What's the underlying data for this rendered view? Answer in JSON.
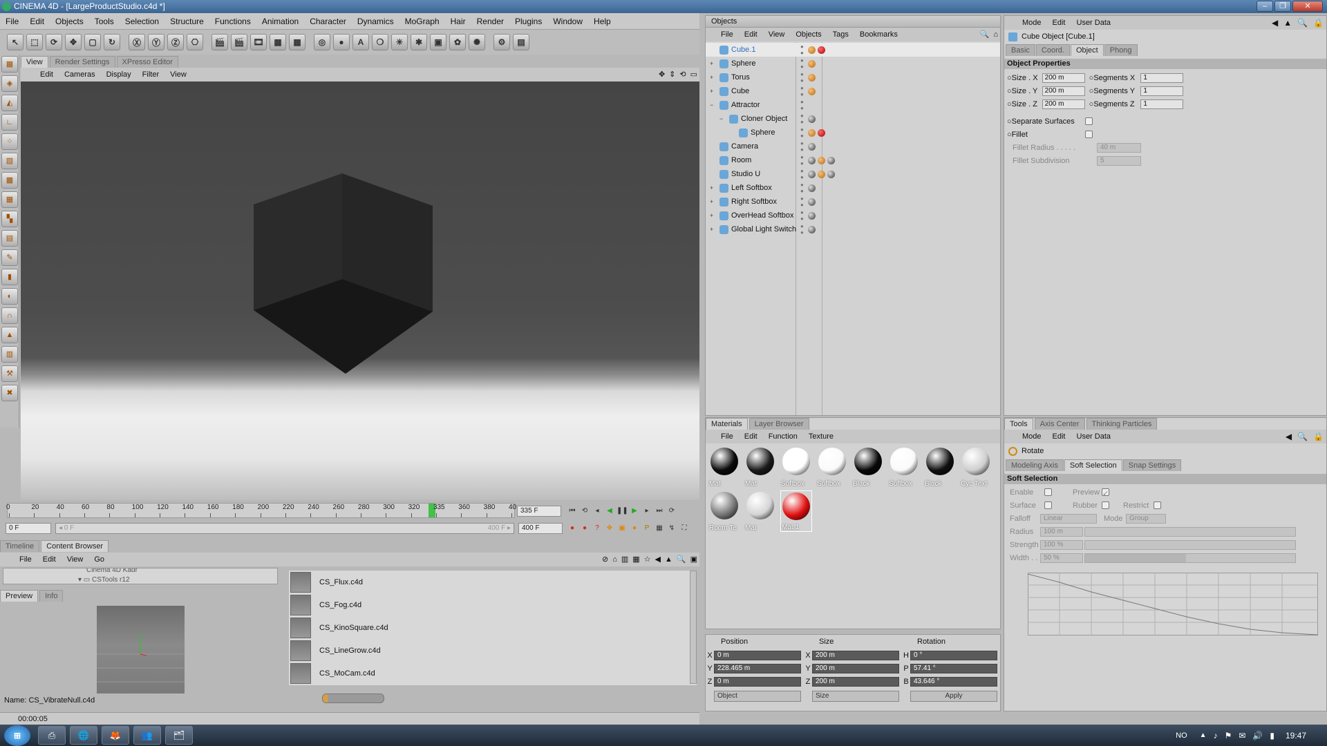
{
  "window": {
    "title": "CINEMA 4D - [LargeProductStudio.c4d *]",
    "buttons": [
      "–",
      "❐",
      "✕"
    ]
  },
  "menu": [
    "File",
    "Edit",
    "Objects",
    "Tools",
    "Selection",
    "Structure",
    "Functions",
    "Animation",
    "Character",
    "Dynamics",
    "MoGraph",
    "Hair",
    "Render",
    "Plugins",
    "Window",
    "Help"
  ],
  "toolbar": {
    "icons": [
      "↖",
      "⬚",
      "⟳",
      "✥",
      "▢",
      "↻",
      "Ⓧ",
      "Ⓨ",
      "Ⓩ",
      "⎔",
      "🎬",
      "🎬",
      "🎞",
      "▦",
      "▦",
      "◎",
      "●",
      "A",
      "❍",
      "✳",
      "✱",
      "▣",
      "✿",
      "✺",
      "⚙",
      "▤"
    ]
  },
  "viewport": {
    "tabs": [
      "View",
      "Render Settings",
      "XPresso Editor"
    ],
    "menu": [
      "Edit",
      "Cameras",
      "Display",
      "Filter",
      "View"
    ],
    "nav_icons": [
      "✥",
      "⇕",
      "⟲",
      "▭"
    ]
  },
  "timeline": {
    "ticks": [
      "0",
      "20",
      "40",
      "60",
      "80",
      "100",
      "120",
      "140",
      "160",
      "180",
      "200",
      "220",
      "240",
      "260",
      "280",
      "300",
      "320",
      "335",
      "360",
      "380",
      "40"
    ],
    "current_frame": "335 F",
    "start": "0 F",
    "range_start": "◂ 0 F",
    "range_end": "400 F ▸",
    "end": "400 F",
    "playhead_fraction": 0.8375
  },
  "playback": [
    "⏮",
    "⟲",
    "◂",
    "◀",
    "❚❚",
    "▶",
    "▸",
    "⏭",
    "⟳"
  ],
  "keys": [
    "●",
    "●",
    "?",
    "✥",
    "▣",
    "●",
    "P",
    "▦",
    "↯",
    "⛶"
  ],
  "bottom_tabs": [
    "Timeline",
    "Content Browser"
  ],
  "content_browser": {
    "menu": [
      "File",
      "Edit",
      "View",
      "Go"
    ],
    "tree": [
      "Cinema 4D Kadr",
      "CSTools r12"
    ],
    "preview_tabs": [
      "Preview",
      "Info"
    ],
    "name": "Name: CS_VibrateNull.c4d",
    "files": [
      "CS_Flux.c4d",
      "CS_Fog.c4d",
      "CS_KinoSquare.c4d",
      "CS_LineGrow.c4d",
      "CS_MoCam.c4d"
    ],
    "nav_icons": [
      "⊘",
      "⌂",
      "▥",
      "▦",
      "☆",
      "◀",
      "▲",
      "🔍",
      "▣"
    ]
  },
  "status": "00:00:05",
  "objects": {
    "title": "Objects",
    "menu": [
      "File",
      "Edit",
      "View",
      "Objects",
      "Tags",
      "Bookmarks"
    ],
    "items": [
      {
        "name": "Cube.1",
        "indent": 0,
        "exp": "",
        "tags": [
          "ob",
          "rb"
        ],
        "sel": true
      },
      {
        "name": "Sphere",
        "indent": 0,
        "exp": "+",
        "tags": [
          "ob"
        ]
      },
      {
        "name": "Torus",
        "indent": 0,
        "exp": "+",
        "tags": [
          "ob"
        ]
      },
      {
        "name": "Cube",
        "indent": 0,
        "exp": "+",
        "tags": [
          "ob"
        ]
      },
      {
        "name": "Attractor",
        "indent": 0,
        "exp": "−",
        "tags": []
      },
      {
        "name": "Cloner Object",
        "indent": 1,
        "exp": "−",
        "tags": [
          "sb"
        ]
      },
      {
        "name": "Sphere",
        "indent": 2,
        "exp": "",
        "tags": [
          "ob",
          "rb"
        ]
      },
      {
        "name": "Camera",
        "indent": 0,
        "exp": "",
        "tags": [
          "sb"
        ]
      },
      {
        "name": "Room",
        "indent": 0,
        "exp": "",
        "tags": [
          "sb",
          "ob",
          "sb"
        ]
      },
      {
        "name": "Studio U",
        "indent": 0,
        "exp": "",
        "tags": [
          "sb",
          "ob",
          "sb"
        ]
      },
      {
        "name": "Left Softbox",
        "indent": 0,
        "exp": "+",
        "tags": [
          "sb"
        ]
      },
      {
        "name": "Right Softbox",
        "indent": 0,
        "exp": "+",
        "tags": [
          "sb"
        ]
      },
      {
        "name": "OverHead Softbox",
        "indent": 0,
        "exp": "+",
        "tags": [
          "sb"
        ]
      },
      {
        "name": "Global Light Switch",
        "indent": 0,
        "exp": "+",
        "tags": [
          "sb"
        ]
      }
    ]
  },
  "attributes": {
    "menu": [
      "Mode",
      "Edit",
      "User Data"
    ],
    "object_title": "Cube Object [Cube.1]",
    "tabs": [
      "Basic",
      "Coord.",
      "Object",
      "Phong"
    ],
    "section": "Object Properties",
    "size_x_label": "Size . X",
    "size_x": "200 m",
    "seg_x_label": "Segments X",
    "seg_x": "1",
    "size_y_label": "Size . Y",
    "size_y": "200 m",
    "seg_y_label": "Segments Y",
    "seg_y": "1",
    "size_z_label": "Size . Z",
    "size_z": "200 m",
    "seg_z_label": "Segments Z",
    "seg_z": "1",
    "separate": "Separate Surfaces",
    "fillet": "Fillet",
    "fillet_radius": "Fillet Radius . . . . .",
    "fillet_radius_val": "40 m",
    "fillet_sub": "Fillet Subdivision",
    "fillet_sub_val": "5"
  },
  "materials": {
    "tabs": [
      "Materials",
      "Layer Browser"
    ],
    "menu": [
      "File",
      "Edit",
      "Function",
      "Texture"
    ],
    "items": [
      {
        "name": "Mat",
        "color": "#0a0a0a"
      },
      {
        "name": "Mat",
        "color": "#1a1a1a"
      },
      {
        "name": "Softbox",
        "color": "#ffffff"
      },
      {
        "name": "Softbox",
        "color": "#fafafa"
      },
      {
        "name": "Black",
        "color": "#080808"
      },
      {
        "name": "Softbox",
        "color": "#fafafa"
      },
      {
        "name": "Black",
        "color": "#101010"
      },
      {
        "name": "Cyc Text",
        "color": "#cfcfcf"
      },
      {
        "name": "Room Te",
        "color": "#777777"
      },
      {
        "name": "Mat",
        "color": "#d5d5d5"
      },
      {
        "name": "Mat.1",
        "color": "#e01010"
      }
    ]
  },
  "coords": {
    "headers": [
      "Position",
      "Size",
      "Rotation"
    ],
    "x": "0 m",
    "y": "228.465 m",
    "z": "0 m",
    "sx": "200 m",
    "sy": "200 m",
    "sz": "200 m",
    "h": "0 °",
    "p": "57.41 °",
    "b": "43.646 °",
    "mode1": "Object",
    "mode2": "Size",
    "apply": "Apply"
  },
  "tools": {
    "tabs": [
      "Tools",
      "Axis Center",
      "Thinking Particles"
    ],
    "menu": [
      "Mode",
      "Edit",
      "User Data"
    ],
    "tool": "Rotate",
    "subtabs": [
      "Modeling Axis",
      "Soft Selection",
      "Snap Settings"
    ],
    "section": "Soft Selection",
    "enable": "Enable",
    "preview": "Preview",
    "surface": "Surface",
    "rubber": "Rubber",
    "restrict": "Restrict",
    "falloff": "Falloff",
    "falloff_val": "Linear",
    "mode": "Mode",
    "mode_val": "Group",
    "radius": "Radius",
    "radius_val": "100 m",
    "strength": "Strength",
    "strength_val": "100 %",
    "width": "Width . .",
    "width_val": "50 %"
  },
  "taskbar": {
    "items": [
      "⊞",
      "⎙",
      "🌐",
      "🦊",
      "👥",
      "🗂"
    ],
    "lang": "NO",
    "tray": [
      "▲",
      "♪",
      "⚑",
      "✉",
      "🔊",
      "▮"
    ],
    "time": "19:47"
  }
}
